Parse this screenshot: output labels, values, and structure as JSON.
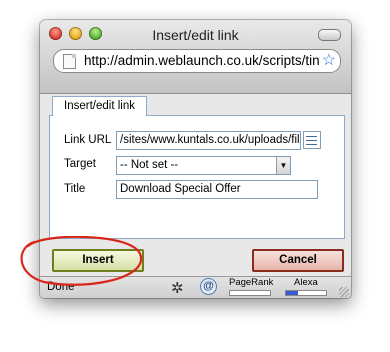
{
  "window": {
    "title": "Insert/edit link"
  },
  "urlbar": {
    "url": "http://admin.weblaunch.co.uk/scripts/tiny_mce/themes/advanced/link.htm"
  },
  "tabs": [
    {
      "label": "Insert/edit link"
    }
  ],
  "form": {
    "link_url": {
      "label": "Link URL",
      "value": "/sites/www.kuntals.co.uk/uploads/files/Download_Special_Offer.pdf"
    },
    "target": {
      "label": "Target",
      "selected": "-- Not set --"
    },
    "title": {
      "label": "Title",
      "value": "Download Special Offer"
    }
  },
  "buttons": {
    "insert": "Insert",
    "cancel": "Cancel"
  },
  "statusbar": {
    "text": "Done",
    "pagerank_label": "PageRank",
    "alexa_label": "Alexa",
    "alexa_level": 0.3
  },
  "colors": {
    "annotation": "#d9261c",
    "focus_tab_border": "#8fa9c8",
    "insert_border": "#6f7f1e",
    "cancel_border": "#8a2d1c"
  },
  "icons": [
    "close-icon",
    "minimize-icon",
    "zoom-icon",
    "page-icon",
    "bookmark-star-icon",
    "browse-list-icon",
    "dropdown-arrow-icon",
    "bug-icon",
    "at-icon",
    "resize-grip-icon"
  ]
}
